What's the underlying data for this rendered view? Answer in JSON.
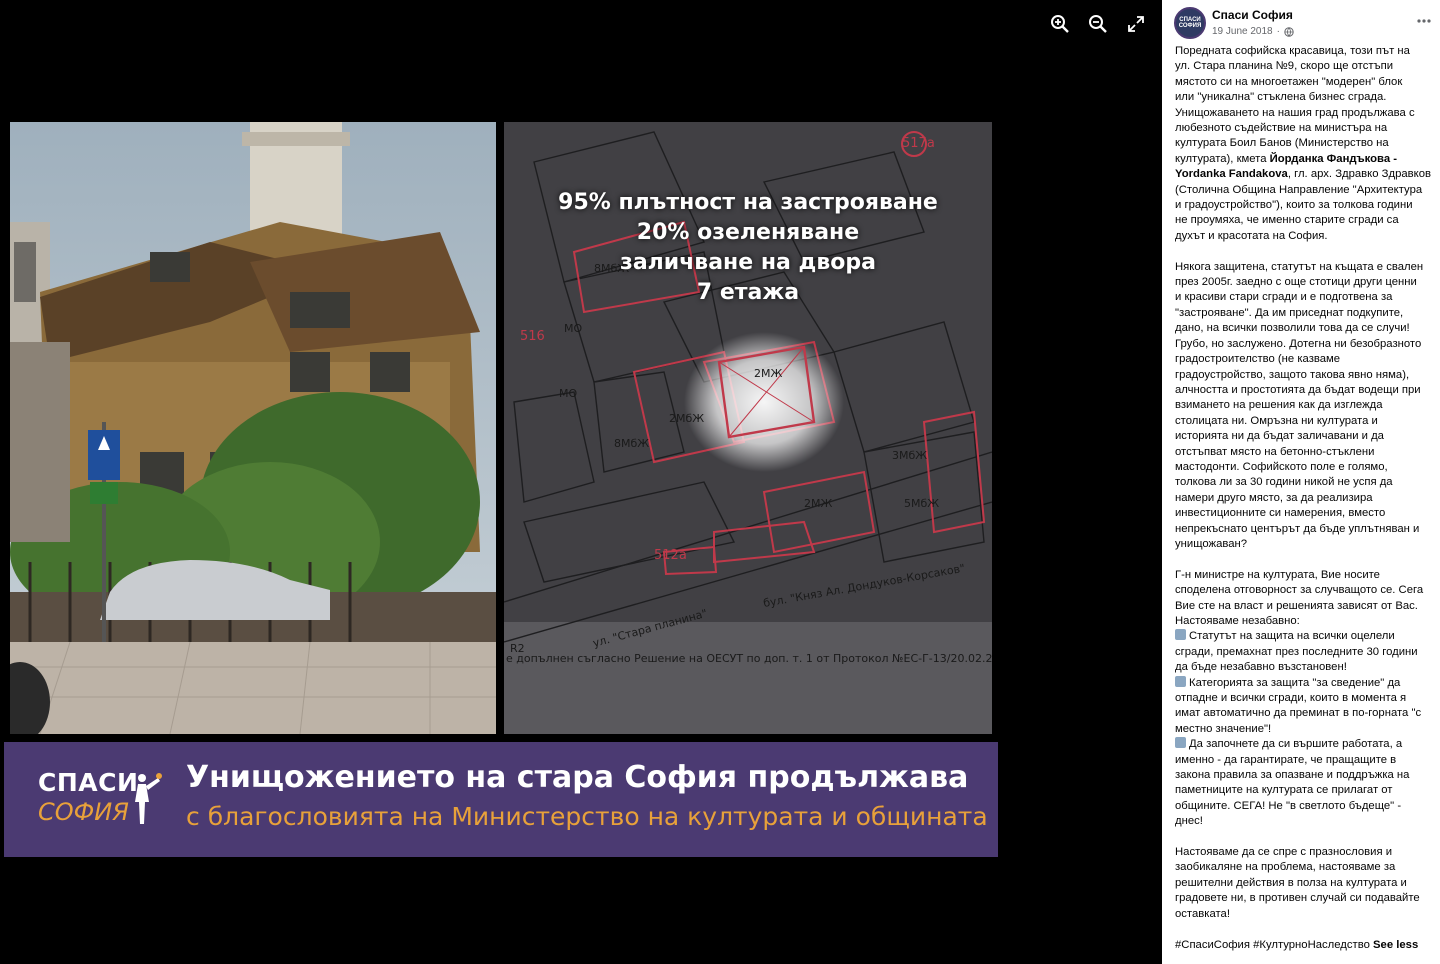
{
  "viewer": {
    "tools": [
      {
        "name": "zoom-in-icon"
      },
      {
        "name": "zoom-out-icon"
      },
      {
        "name": "fullscreen-icon"
      }
    ],
    "image": {
      "plan_overlay_lines": [
        "95% плътност на застрояване",
        "20% озеленяване",
        "заличване на двора",
        "7 етажа"
      ],
      "banner": {
        "logo_top": "СПАСИ",
        "logo_bottom": "СОФИЯ",
        "title": "Унищожението на стара София продължава",
        "subtitle": "с благословията на Министерство на културата и общината"
      },
      "street_sign": "517a",
      "plan_labels": {
        "street": "ул. \"Стара планина\"",
        "boulevard": "бул. \"Княз Ал. Дондуков-Корсаков\"",
        "block_516": "516",
        "block_512": "512a"
      }
    }
  },
  "post": {
    "page_name": "Спаси София",
    "date": "19 June 2018",
    "avatar_text": "СПАСИ СОФИЯ",
    "paragraphs": [
      {
        "lines": [
          "Поредната софийска красавица, този път на",
          "ул. Стара планина №9, скоро ще отстъпи",
          "мястото си на многоетажен \"модерен\" блок",
          "или \"уникална\" стъклена бизнес сграда.",
          "Унищожаването на нашия град продължава с",
          "любезното съдействие на министъра на",
          "културата Боил Банов (Министерство на",
          "културата), кмета ",
          "Yordanka Fandakova",
          "(Столична Община Направление \"Архитектура",
          "и градоустройство\"), които за толкова години",
          "не проумяха, че именно старите сгради са",
          "духът и красотата на София."
        ],
        "mayor_bold": "Йорданка Фандъкова -",
        "after_mayor": ", гл. арх. Здравко Здравков"
      },
      {
        "lines": [
          "Някога защитена, статутът на къщата е свален",
          "през 2005г. заедно с още стотици други ценни",
          "и красиви стари сгради и е подготвена за",
          "\"застрояване\". Да им приседнат подкупите,",
          "дано, на всички позволили това да се случи!",
          "Грубо, но заслужено. Дотегна ни безобразното",
          "градостроителство (не казваме",
          "градоустройство, защото такова явно няма),",
          "алчността и простотията да бъдат водещи при",
          "взимането на решения как да изглежда",
          "столицата ни. Омръзна ни културата и",
          "историята ни да бъдат заличавани и да",
          "отстъпват място на бетонно-стъклени",
          "мастодонти. Софийското поле е голямо,",
          "толкова ли за 30 години никой не успя да",
          "намери друго място, за да реализира",
          "инвестиционните си намерения, вместо",
          "непрекъснато центърът да бъде уплътняван и",
          "унищожаван?"
        ]
      },
      {
        "lines": [
          "Г-н министре на културата, Вие носите",
          "споделена отговорност за случващото се. Сега",
          "Вие сте на власт и решенията зависят от Вас.",
          "Настояваме незабавно:"
        ],
        "items": [
          {
            "icon": "keycap-1-icon",
            "lines": [
              "Статутът на защита на всички оцелели",
              "сгради, премахнат през последните 30 години",
              "да бъде незабавно възстановен!"
            ]
          },
          {
            "icon": "keycap-2-icon",
            "lines": [
              "Категорията за защита \"за сведение\" да",
              "отпадне и всички сгради, които в момента я",
              "имат автоматично да преминат в по-горната \"с",
              "местно значение\"!"
            ]
          },
          {
            "icon": "keycap-3-icon",
            "lines": [
              "Да започнете да си вършите работата, а",
              "именно - да гарантирате, че пращащите в",
              "закона правила за опазване и поддръжка на",
              "паметниците на културата се прилагат от",
              "общините. СЕГА! Не \"в светлото бъдеще\" -",
              "днес!"
            ]
          }
        ]
      },
      {
        "lines": [
          "Настояваме да се спре с празнословия и",
          "заобикаляне на проблема, настояваме за",
          "решителни действия в полза на културата и",
          "градовете ни, в противен случай си подавайте",
          "оставката!"
        ]
      }
    ],
    "hashtags": "#СпасиСофия #КултурноНаследство",
    "see_less": "See less"
  }
}
